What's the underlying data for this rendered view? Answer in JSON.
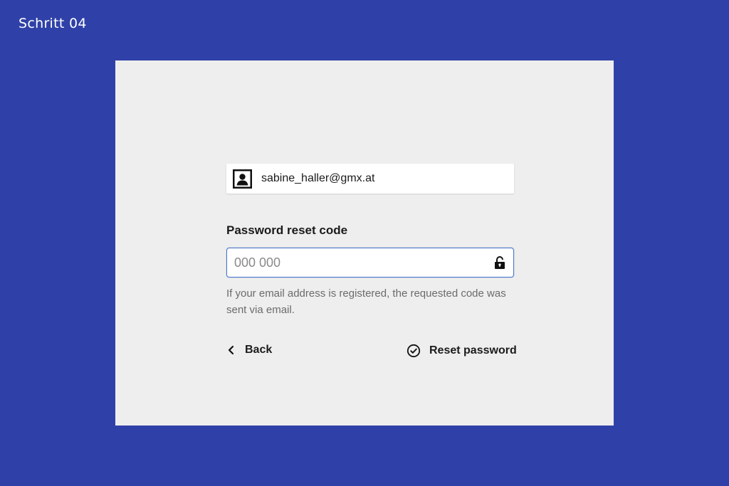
{
  "page": {
    "step_label": "Schritt 04",
    "background_color": "#2f41a8",
    "card_color": "#eeeeee"
  },
  "account": {
    "email": "sabine_haller@gmx.at",
    "icon": "user-avatar-icon"
  },
  "form": {
    "code_label": "Password reset code",
    "code_placeholder": "000 000",
    "code_value": "",
    "field_icon": "unlock-icon",
    "hint": "If your email address is registered, the requested code was sent via email."
  },
  "actions": {
    "back_label": "Back",
    "back_icon": "chevron-left-icon",
    "reset_label": "Reset password",
    "reset_icon": "check-circle-icon"
  }
}
